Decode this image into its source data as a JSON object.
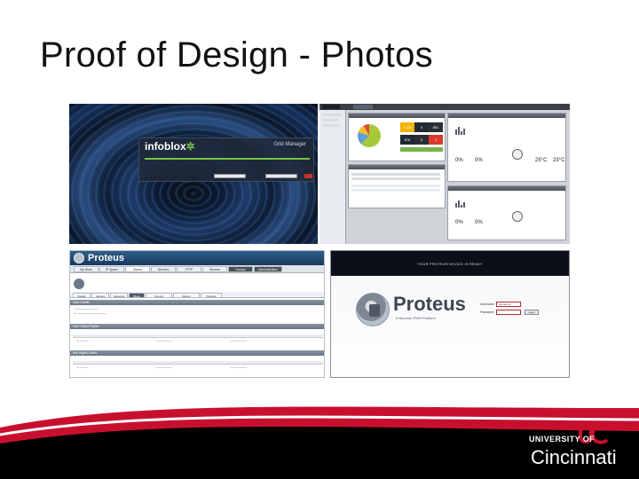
{
  "slide": {
    "title": "Proof of Design - Photos"
  },
  "screenshot_infoblox": {
    "logo": "infoblox",
    "subtitle": "Grid Manager"
  },
  "screenshot_dashboard": {
    "tabs": [
      "Dashboard",
      "Grid Management",
      "Smart Folders",
      "Data Management",
      "Administration"
    ],
    "stats": [
      "7,526",
      "0",
      "851",
      "676",
      "0",
      "2",
      "0%",
      "0%",
      "0%",
      "0%",
      "25°C",
      "23°C"
    ]
  },
  "screenshot_app": {
    "brand": "Proteus",
    "nav_tabs": [
      "My Work",
      "IP Space",
      "Zones",
      "Devices",
      "TFTP",
      "Servers",
      "Groups",
      "Administration"
    ],
    "subnav_tabs": [
      "Details",
      "Servers",
      "Networks",
      "Block",
      "Groups",
      "Alarms",
      "Settings",
      "Audit",
      "Access Rights"
    ],
    "sections": [
      "User Details",
      "User Object Rights",
      "Key Rights Users"
    ]
  },
  "screenshot_login": {
    "banner": "YOUR PROTEUS DEVICE IS READY",
    "brand": "Proteus",
    "tagline": "Enterprise IPAM Platform",
    "username_label": "Username",
    "password_label": "Password",
    "username_value": "bamadmin",
    "button": "Login"
  },
  "branding": {
    "university_top": "UNIVERSITY OF",
    "university_name": "Cincinnati"
  },
  "colors": {
    "uc_red": "#c8102e",
    "uc_black": "#000000"
  }
}
